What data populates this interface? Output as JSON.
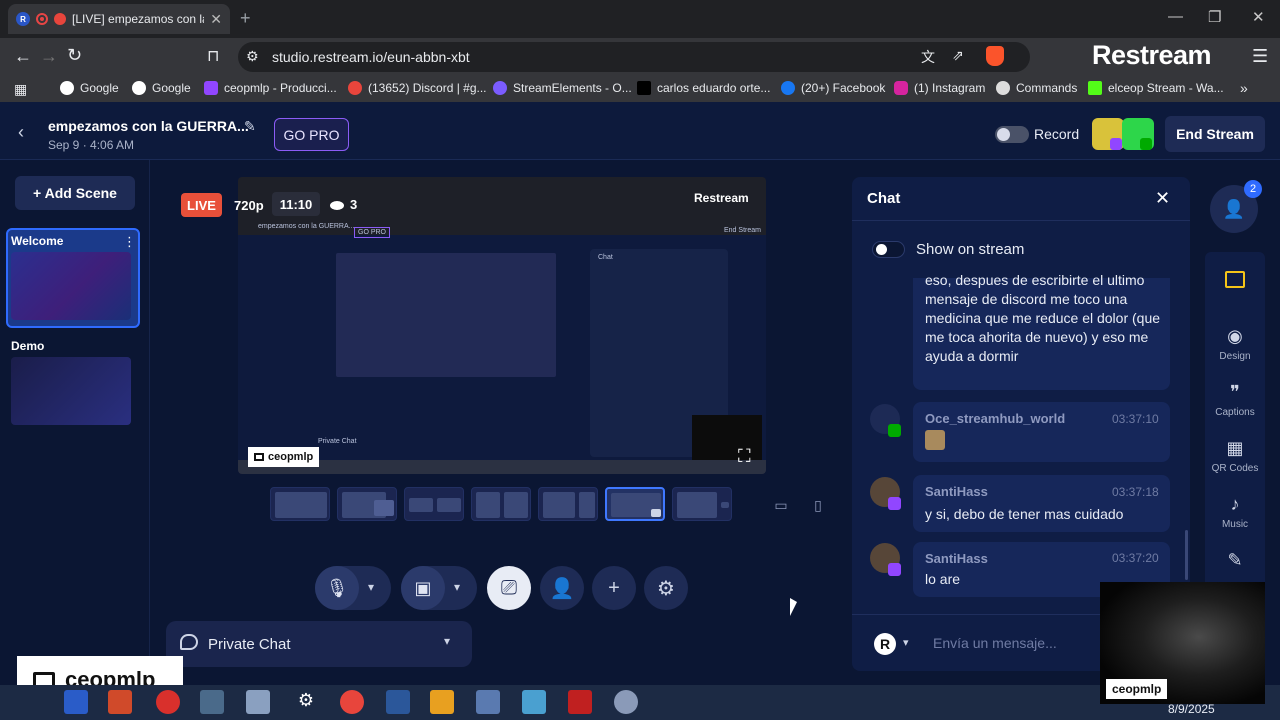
{
  "browser": {
    "tab_title": "[LIVE] empezamos con la",
    "url": "studio.restream.io/eun-abbn-xbt",
    "brand_logo": "Restream",
    "bookmarks": [
      "Google",
      "Google",
      "ceopmlp - Producci...",
      "(13652) Discord | #g...",
      "StreamElements - O...",
      "carlos eduardo orte...",
      "(20+) Facebook",
      "(1) Instagram",
      "Commands",
      "elceop Stream - Wa..."
    ],
    "icons": {
      "minimize": "minimize-icon",
      "maximize": "maximize-icon",
      "close": "close-icon",
      "translate": "translate-icon",
      "share": "share-icon",
      "brave": "brave-shield-icon"
    }
  },
  "header": {
    "stream_title": "empezamos con la GUERRA...",
    "stream_date": "Sep 9 · 4:06 AM",
    "go_pro": "GO PRO",
    "record_label": "Record",
    "end_stream": "End Stream"
  },
  "scenes": {
    "add_scene": "+ Add Scene",
    "items": [
      {
        "label": "Welcome",
        "active": true
      },
      {
        "label": "Demo",
        "active": false
      }
    ]
  },
  "preview": {
    "live_badge": "LIVE",
    "resolution": "720p",
    "timer": "11:10",
    "viewers": "3",
    "overlay_name": "ceopmlp",
    "inner_labels": {
      "logo": "Restream",
      "title": "empezamos con la GUERRA...",
      "go_pro": "GO PRO",
      "end_stream": "End Stream",
      "chat": "Chat",
      "private_chat": "Private Chat"
    }
  },
  "layouts": {
    "count": 7,
    "active_index": 5
  },
  "controls": {
    "private_chat_label": "Private Chat"
  },
  "name_tag": "ceopmlp",
  "chat": {
    "title": "Chat",
    "show_on_stream": "Show on stream",
    "messages": [
      {
        "user": "",
        "time": "",
        "text": "eso, despues de escribirte el ultimo mensaje de discord me toco una medicina que me reduce el dolor (que me toca ahorita de nuevo) y eso me ayuda a dormir"
      },
      {
        "user": "Oce_streamhub_world",
        "time": "03:37:10",
        "text": ""
      },
      {
        "user": "SantiHass",
        "time": "03:37:18",
        "text": "y si, debo de tener mas cuidado"
      },
      {
        "user": "SantiHass",
        "time": "03:37:20",
        "text": "lo are"
      }
    ],
    "input_placeholder": "Envía un mensaje...",
    "sender_initial": "R"
  },
  "rail": {
    "invite_count": "2",
    "items": [
      "Design",
      "Captions",
      "QR Codes",
      "Music"
    ]
  },
  "webcam_tag": "ceopmlp",
  "taskbar": {
    "date": "8/9/2025"
  },
  "colors": {
    "accent_blue": "#2f6bff",
    "live_red": "#e8503a",
    "gopro_border": "#8b5cf6",
    "twitch_purple": "#9146ff",
    "kick_green": "#2dd64a"
  }
}
